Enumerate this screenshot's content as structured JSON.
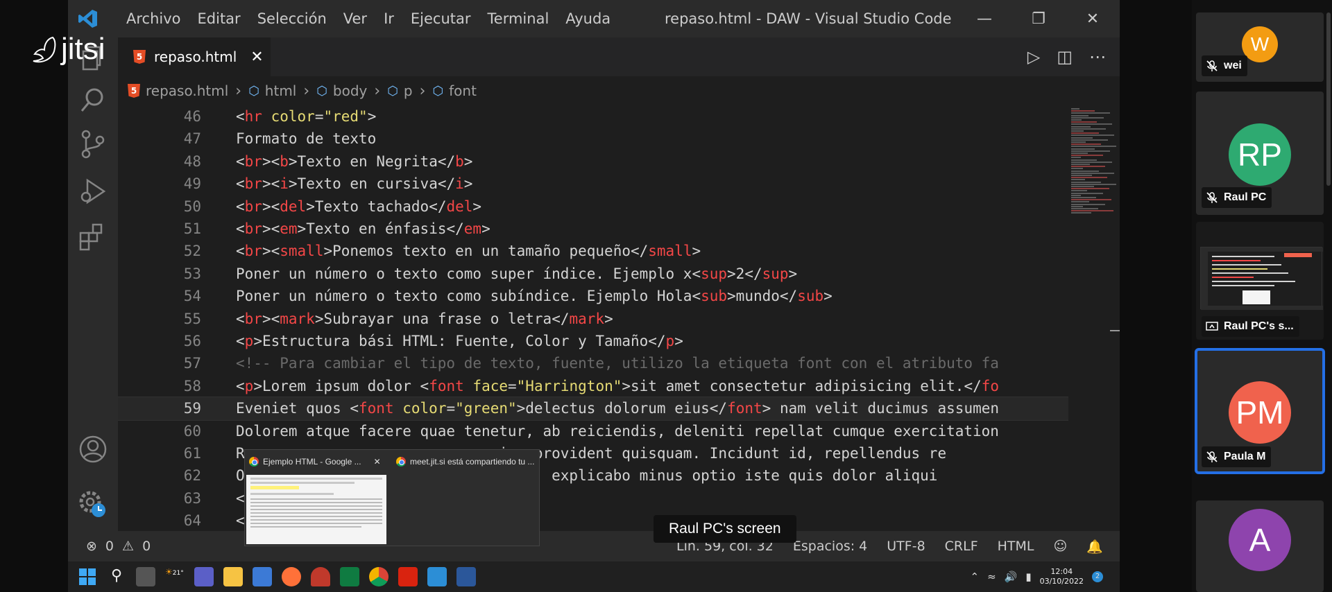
{
  "window": {
    "title": "repaso.html - DAW - Visual Studio Code",
    "menu": [
      "Archivo",
      "Editar",
      "Selección",
      "Ver",
      "Ir",
      "Ejecutar",
      "Terminal",
      "Ayuda"
    ]
  },
  "tab": {
    "label": "repaso.html"
  },
  "breadcrumb": [
    "repaso.html",
    "html",
    "body",
    "p",
    "font"
  ],
  "editor": {
    "lines": [
      {
        "n": "46",
        "html": "<span class='ang'>&lt;</span><span class='tg'>hr</span> <span class='at'>color</span>=<span class='str'>\"red\"</span><span class='ang'>&gt;</span>"
      },
      {
        "n": "47",
        "html": "Formato de texto"
      },
      {
        "n": "48",
        "html": "&lt;<span class='tg'>br</span>&gt;&lt;<span class='tg'>b</span>&gt;Texto en Negrita&lt;/<span class='tg'>b</span>&gt;"
      },
      {
        "n": "49",
        "html": "&lt;<span class='tg'>br</span>&gt;&lt;<span class='tg'>i</span>&gt;Texto en cursiva&lt;/<span class='tg'>i</span>&gt;"
      },
      {
        "n": "50",
        "html": "&lt;<span class='tg'>br</span>&gt;&lt;<span class='tg'>del</span>&gt;Texto tachado&lt;/<span class='tg'>del</span>&gt;"
      },
      {
        "n": "51",
        "html": "&lt;<span class='tg'>br</span>&gt;&lt;<span class='tg'>em</span>&gt;Texto en énfasis&lt;/<span class='tg'>em</span>&gt;"
      },
      {
        "n": "52",
        "html": "&lt;<span class='tg'>br</span>&gt;&lt;<span class='tg'>small</span>&gt;Ponemos texto en un tamaño pequeño&lt;/<span class='tg'>small</span>&gt;"
      },
      {
        "n": "53",
        "html": "Poner un número o texto como super índice. Ejemplo x&lt;<span class='tg'>sup</span>&gt;2&lt;/<span class='tg'>sup</span>&gt;"
      },
      {
        "n": "54",
        "html": "Poner un número o texto como subíndice. Ejemplo Hola&lt;<span class='tg'>sub</span>&gt;mundo&lt;/<span class='tg'>sub</span>&gt;"
      },
      {
        "n": "55",
        "html": "&lt;<span class='tg'>br</span>&gt;&lt;<span class='tg'>mark</span>&gt;Subrayar una frase o letra&lt;/<span class='tg'>mark</span>&gt;"
      },
      {
        "n": "56",
        "html": "&lt;<span class='tg'>p</span>&gt;Estructura bási HTML: Fuente, Color y Tamaño&lt;/<span class='tg'>p</span>&gt;"
      },
      {
        "n": "57",
        "html": "<span class='cm'>&lt;!-- Para cambiar el tipo de texto, fuente, utilizo la etiqueta font con el atributo fa</span>"
      },
      {
        "n": "58",
        "html": "&lt;<span class='tg'>p</span>&gt;Lorem ipsum dolor &lt;<span class='tg'>font</span> <span class='at'>face</span>=<span class='str'>\"Harrington\"</span>&gt;sit amet consectetur adipisicing elit.&lt;/<span class='tg'>fo</span>"
      },
      {
        "n": "59",
        "html": "Eveniet quos &lt;<span class='tg'>font</span> <span class='at'>color</span>=<span class='str'>\"green\"</span>&gt;delectus dolorum eius&lt;/<span class='tg'>font</span>&gt; nam velit ducimus assumen"
      },
      {
        "n": "60",
        "html": "Dolorem atque facere quae tenetur, ab reiciendis, deleniti repellat cumque exercitation"
      },
      {
        "n": "61",
        "html": "Rem,                          ium provident quisquam. Incidunt id, repellendus re"
      },
      {
        "n": "62",
        "html": "Offi                          agni, explicabo minus optio iste quis dolor aliqui"
      },
      {
        "n": "63",
        "html": "&lt;/<span class='tg'>bo</span>"
      },
      {
        "n": "64",
        "html": "&lt;/<span class='tg'>htm</span>"
      }
    ]
  },
  "statusbar": {
    "errors": "0",
    "warnings": "0",
    "position": "Lín. 59, col. 32",
    "spaces": "Espacios: 4",
    "encoding": "UTF-8",
    "eol": "CRLF",
    "language": "HTML"
  },
  "taskbar": {
    "temp": "21°",
    "time": "12:04",
    "date": "03/10/2022",
    "notifications": "2"
  },
  "preview": {
    "tab1": "Ejemplo HTML - Google ...",
    "tab2": "meet.jit.si está compartiendo tu ..."
  },
  "jitsi": {
    "logo": "jitsi",
    "screen_label": "Raul PC's screen",
    "participants": [
      {
        "initial": "W",
        "name": "wei",
        "color": "#f39c12"
      },
      {
        "initial": "RP",
        "name": "Raul PC",
        "color": "#2eaa71"
      },
      {
        "initial": "",
        "name": "Raul PC's s...",
        "color": ""
      },
      {
        "initial": "PM",
        "name": "Paula M",
        "color": "#f0624d"
      },
      {
        "initial": "A",
        "name": "",
        "color": "#8e44ad"
      }
    ]
  }
}
